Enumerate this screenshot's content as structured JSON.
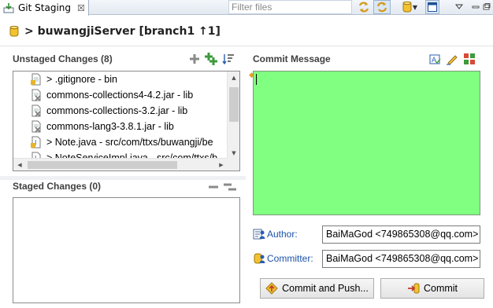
{
  "tab": {
    "title": "Git Staging",
    "close_glyph": "☒"
  },
  "toolbar": {
    "filter_placeholder": "Filter files"
  },
  "header": {
    "repository": "> buwangjiServer [branch1 ↑1]"
  },
  "unstaged": {
    "title": "Unstaged Changes (8)",
    "files": [
      {
        "label": "> .gitignore - bin",
        "icon": "text-file-modified-icon"
      },
      {
        "label": "commons-collections4-4.2.jar - lib",
        "icon": "jar-file-removed-icon"
      },
      {
        "label": "commons-collections-3.2.jar - lib",
        "icon": "jar-file-removed-icon"
      },
      {
        "label": "commons-lang3-3.8.1.jar - lib",
        "icon": "jar-file-removed-icon"
      },
      {
        "label": "> Note.java - src/com/ttxs/buwangji/be",
        "icon": "java-file-modified-icon"
      },
      {
        "label": "> NoteServiceImpl.java - src/com/ttxs/b",
        "icon": "java-file-modified-icon"
      }
    ]
  },
  "staged": {
    "title": "Staged Changes (0)"
  },
  "commit": {
    "title": "Commit Message",
    "message": "",
    "background": "#80ff80",
    "author_label": "Author:",
    "author_value": "BaiMaGod <749865308@qq.com>",
    "committer_label": "Committer:",
    "committer_value": "BaiMaGod <749865308@qq.com>",
    "commit_push_label": "Commit and Push...",
    "commit_label": "Commit"
  },
  "colors": {
    "accent_green": "#3d9a3d",
    "link_blue": "#1b52a8",
    "folder_yellow": "#e6b42a"
  }
}
